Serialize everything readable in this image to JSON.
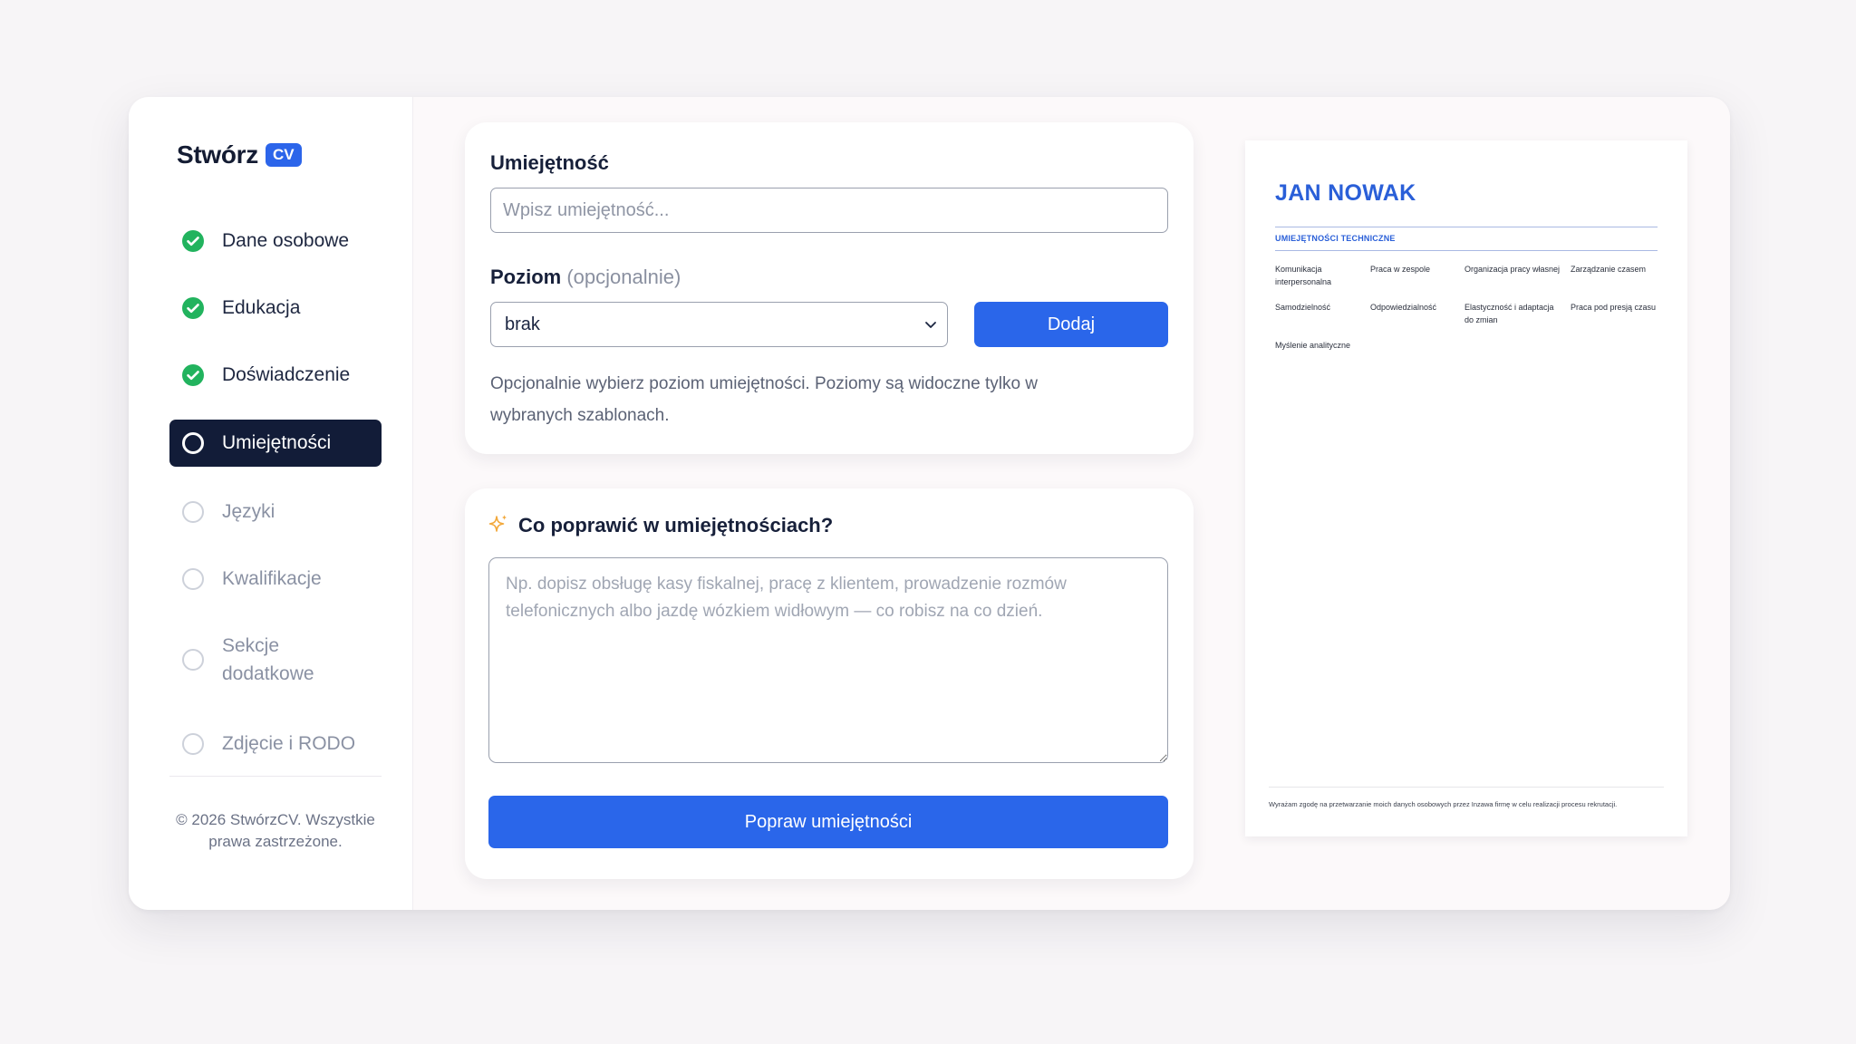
{
  "brand": {
    "name": "Stwórz",
    "badge": "CV"
  },
  "nav": [
    {
      "label": "Dane osobowe",
      "status": "done"
    },
    {
      "label": "Edukacja",
      "status": "done"
    },
    {
      "label": "Doświadczenie",
      "status": "done"
    },
    {
      "label": "Umiejętności",
      "status": "active"
    },
    {
      "label": "Języki",
      "status": "pending"
    },
    {
      "label": "Kwalifikacje",
      "status": "pending"
    },
    {
      "label": "Sekcje dodatkowe",
      "status": "pending"
    },
    {
      "label": "Zdjęcie i RODO",
      "status": "pending"
    }
  ],
  "copyright": "© 2026 StwórzCV. Wszystkie prawa zastrzeżone.",
  "skill_form": {
    "skill_label": "Umiejętność",
    "skill_placeholder": "Wpisz umiejętność...",
    "level_label": "Poziom",
    "level_optional": "(opcjonalnie)",
    "level_value": "brak",
    "add_button": "Dodaj",
    "helper": "Opcjonalnie wybierz poziom umiejętności. Poziomy są widoczne tylko w wybranych szablonach."
  },
  "improve": {
    "title": "Co poprawić w umiejętnościach?",
    "placeholder": "Np. dopisz obsługę kasy fiskalnej, pracę z klientem, prowadzenie rozmów telefonicznych albo jazdę wózkiem widłowym — co robisz na co dzień.",
    "button": "Popraw umiejętności"
  },
  "preview": {
    "name": "JAN NOWAK",
    "section": "UMIEJĘTNOŚCI TECHNICZNE",
    "skills": [
      "Komunikacja interpersonalna",
      "Praca w zespole",
      "Organizacja pracy własnej",
      "Zarządzanie czasem",
      "Samodzielność",
      "Odpowiedzialność",
      "Elastyczność i adaptacja do zmian",
      "Praca pod presją czasu",
      "Myślenie analityczne"
    ],
    "footer": "Wyrażam zgodę na przetwarzanie moich danych osobowych przez Inzawa firmę w celu realizacji procesu rekrutacji."
  },
  "colors": {
    "accent": "#2a66ea",
    "active_nav": "#121c38",
    "check": "#22b35e",
    "sparkle": "#f2a83b"
  },
  "icons": {
    "done": "check-circle-icon",
    "pending": "empty-circle-icon",
    "select": "chevron-down-icon",
    "ai": "sparkle-icon"
  }
}
